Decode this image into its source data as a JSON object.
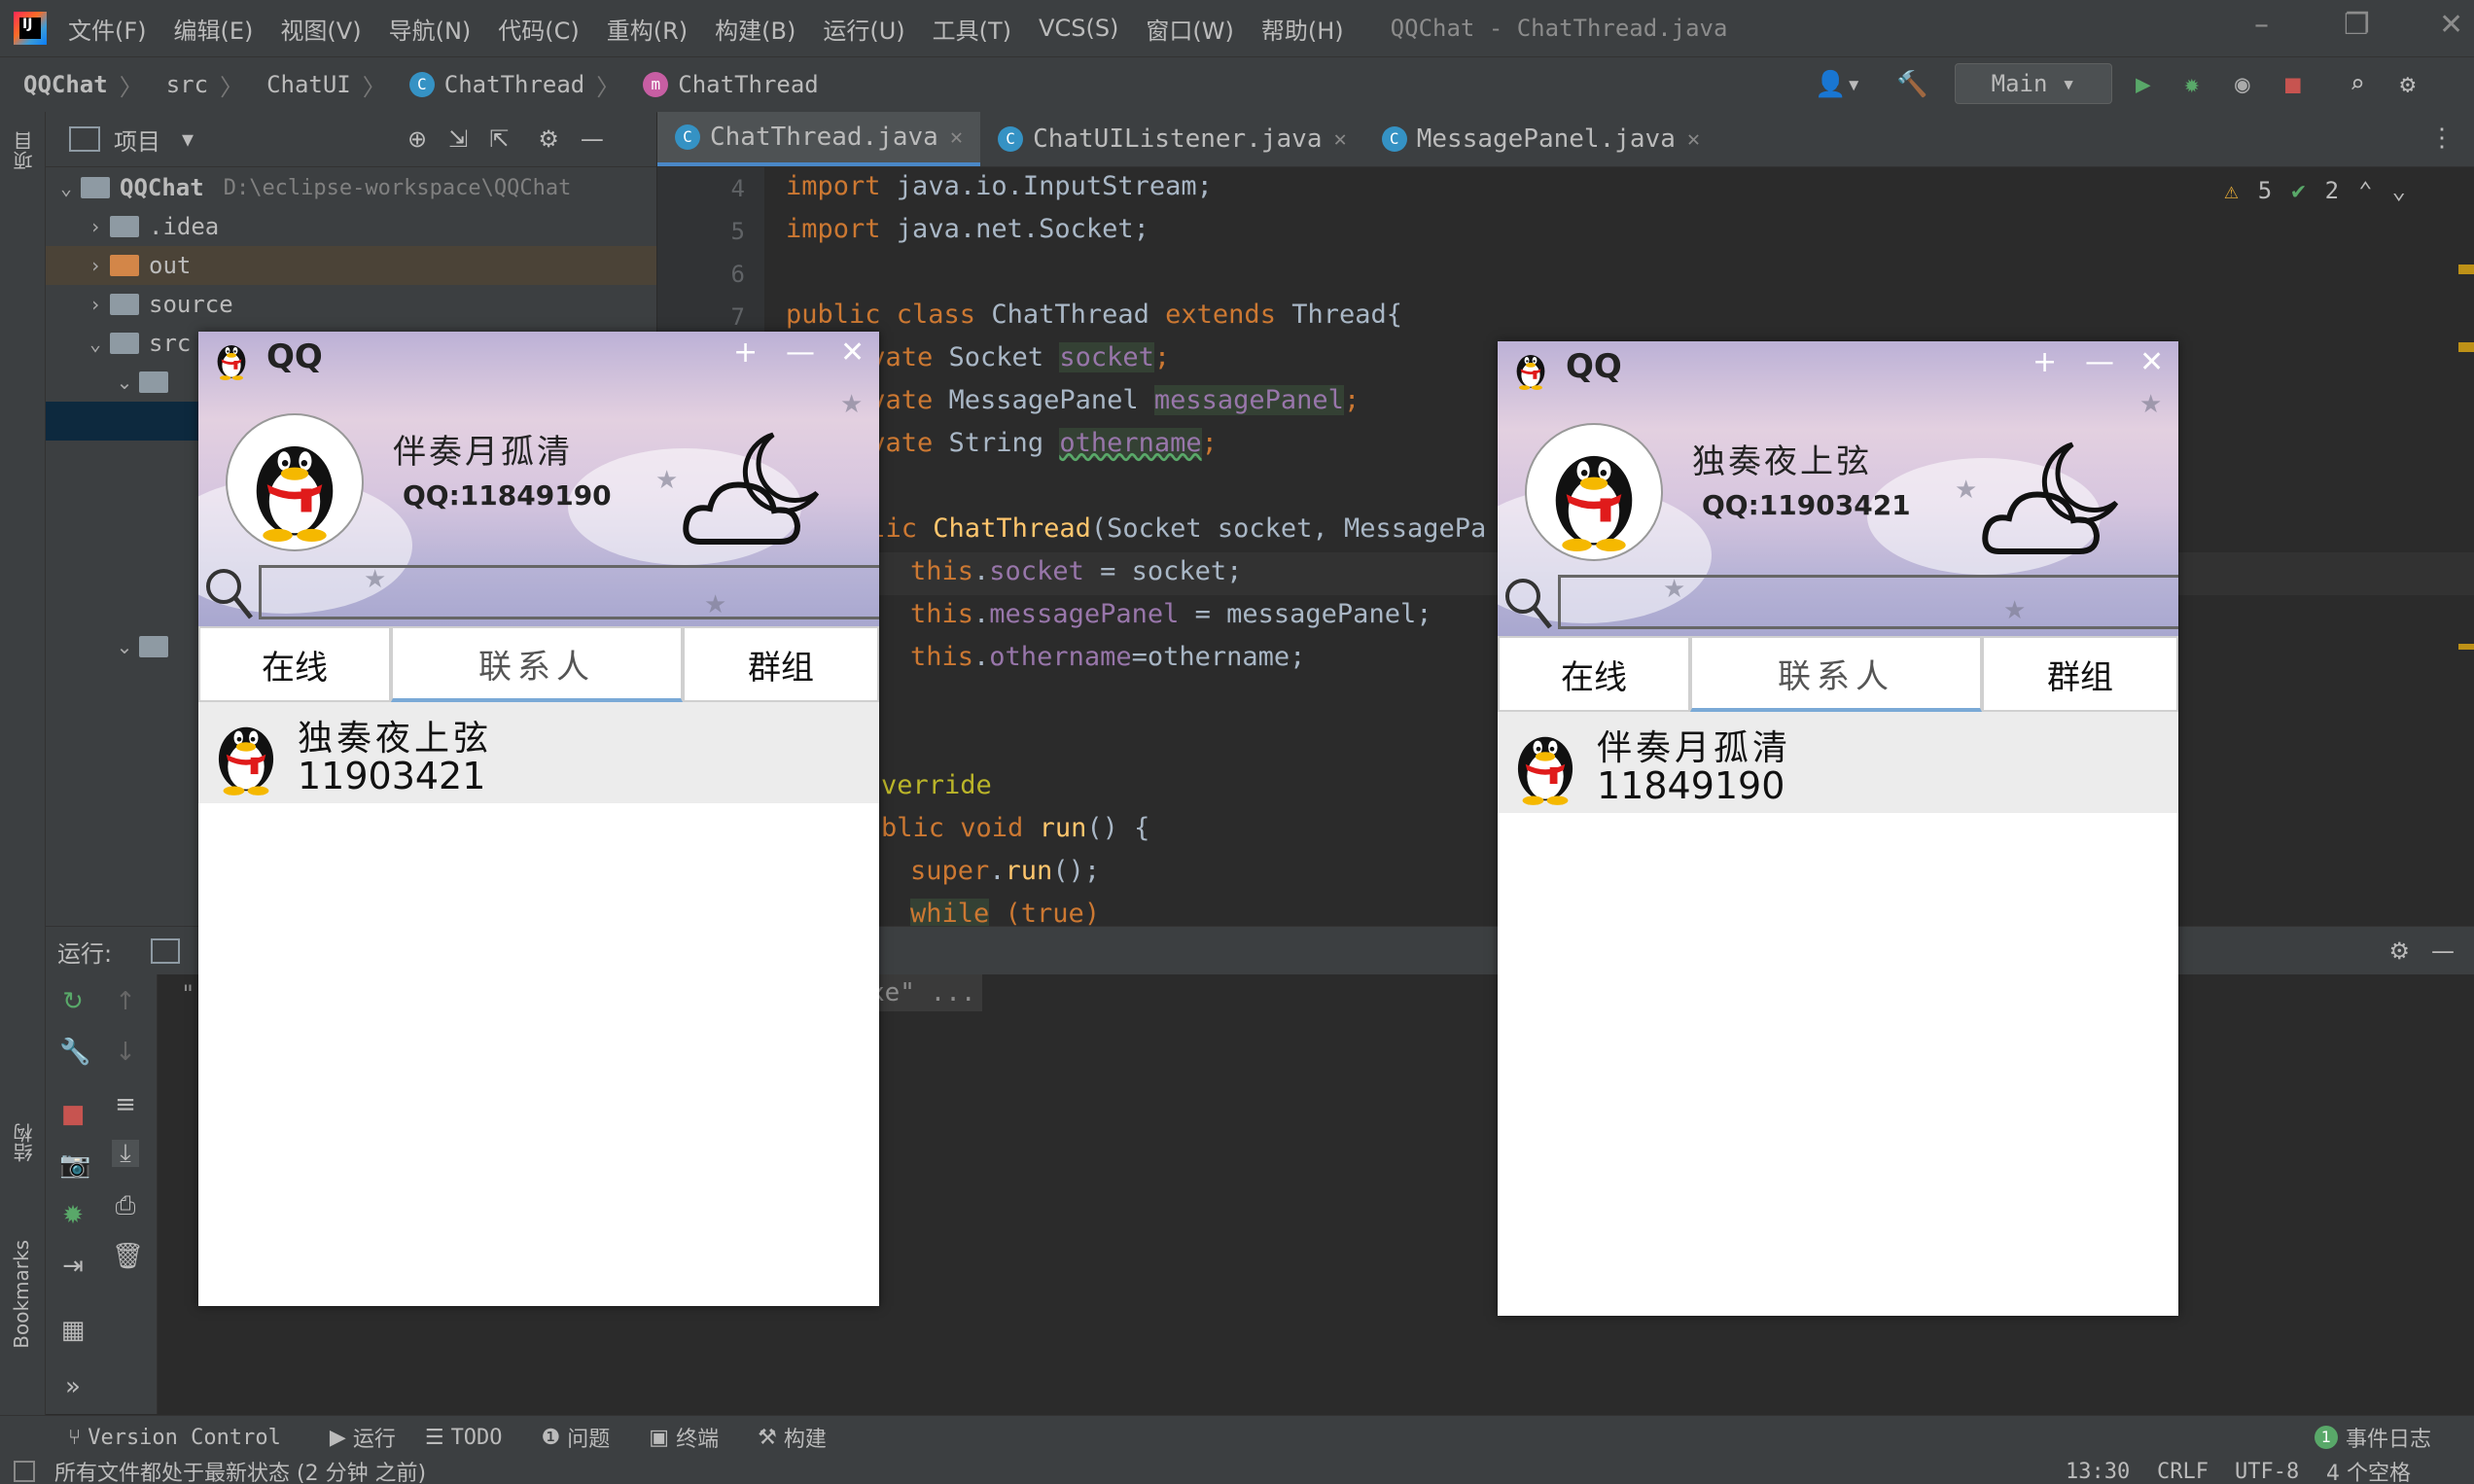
{
  "menubar": {
    "items": [
      "文件(F)",
      "编辑(E)",
      "视图(V)",
      "导航(N)",
      "代码(C)",
      "重构(R)",
      "构建(B)",
      "运行(U)",
      "工具(T)",
      "VCS(S)",
      "窗口(W)",
      "帮助(H)"
    ],
    "window_title": "QQChat - ChatThread.java"
  },
  "navbar": {
    "crumbs": [
      "QQChat",
      "src",
      "ChatUI",
      "ChatThread",
      "ChatThread"
    ],
    "run_config": "Main"
  },
  "project": {
    "header": "项目",
    "root": "QQChat",
    "root_path": "D:\\eclipse-workspace\\QQChat",
    "items": [
      ".idea",
      "out",
      "source",
      "src"
    ]
  },
  "editor": {
    "tabs": [
      "ChatThread.java",
      "ChatUIListener.java",
      "MessagePanel.java"
    ],
    "warn_count": "5",
    "ok_count": "2",
    "line_numbers": [
      "4",
      "5",
      "6",
      "7"
    ],
    "lines": [
      {
        "kw": "import",
        "rest": " java.io.InputStream;"
      },
      {
        "kw": "import",
        "rest": " java.net.Socket;"
      },
      {
        "kw": "",
        "rest": ""
      },
      {
        "kw": "public class",
        "rest": " ChatThread ",
        "kw2": "extends",
        "rest2": " Thread{"
      },
      {
        "kw": "ivate",
        "rest": " Socket ",
        "fld": "socket",
        "end": ";"
      },
      {
        "kw": "ivate",
        "rest": " MessagePanel ",
        "fld": "messagePanel",
        "end": ";"
      },
      {
        "kw": "ivate",
        "rest": " String ",
        "fld": "othername",
        "end": ";"
      },
      {
        "kw": "",
        "rest": ""
      },
      {
        "kw": "blic",
        "rest": " ",
        "fn": "ChatThread",
        "rest2": "(Socket socket, MessagePa"
      },
      {
        "kw": "this",
        "rest": ".",
        "fld": "socket",
        "end": " = socket;"
      },
      {
        "kw": "this",
        "rest": ".",
        "fld": "messagePanel",
        "end": " = messagePanel;"
      },
      {
        "kw": "this",
        "rest": ".",
        "fld": "othername",
        "end": "=othername;"
      },
      {
        "kw": "",
        "rest": ""
      },
      {
        "kw": "",
        "rest": ""
      },
      {
        "ann": "verride"
      },
      {
        "kw": "blic void",
        "rest": " ",
        "fn": "run",
        "rest2": "() {"
      },
      {
        "kw": "super",
        "rest": ".",
        "fn": "run",
        "rest2": "();"
      },
      {
        "kw": "while",
        "rest": " (true)"
      }
    ]
  },
  "run": {
    "label": "运行:",
    "console_left": "\"",
    "console_right": "xe\" ..."
  },
  "tool_tabs": [
    "Version Control",
    "运行",
    "TODO",
    "问题",
    "终端",
    "构建"
  ],
  "event_log": "事件日志",
  "event_count": "1",
  "status": {
    "message": "所有文件都处于最新状态 (2 分钟 之前)",
    "position": "13:30",
    "line_sep": "CRLF",
    "encoding": "UTF-8",
    "indent": "4 个空格"
  },
  "left_strip": {
    "project": "项目",
    "structure": "结构",
    "bookmarks": "Bookmarks"
  },
  "qq_left": {
    "title": "QQ",
    "nickname": "伴奏月孤清",
    "qq_number": "QQ:11849190",
    "tabs": [
      "在线",
      "联系人",
      "群组"
    ],
    "contact_name": "独奏夜上弦",
    "contact_number": "11903421"
  },
  "qq_right": {
    "title": "QQ",
    "nickname": "独奏夜上弦",
    "qq_number": "QQ:11903421",
    "tabs": [
      "在线",
      "联系人",
      "群组"
    ],
    "contact_name": "伴奏月孤清",
    "contact_number": "11849190"
  },
  "colors": {
    "accent": "#4a88c7",
    "keyword": "#cc7832",
    "field": "#9876aa",
    "function": "#ffc66d"
  }
}
